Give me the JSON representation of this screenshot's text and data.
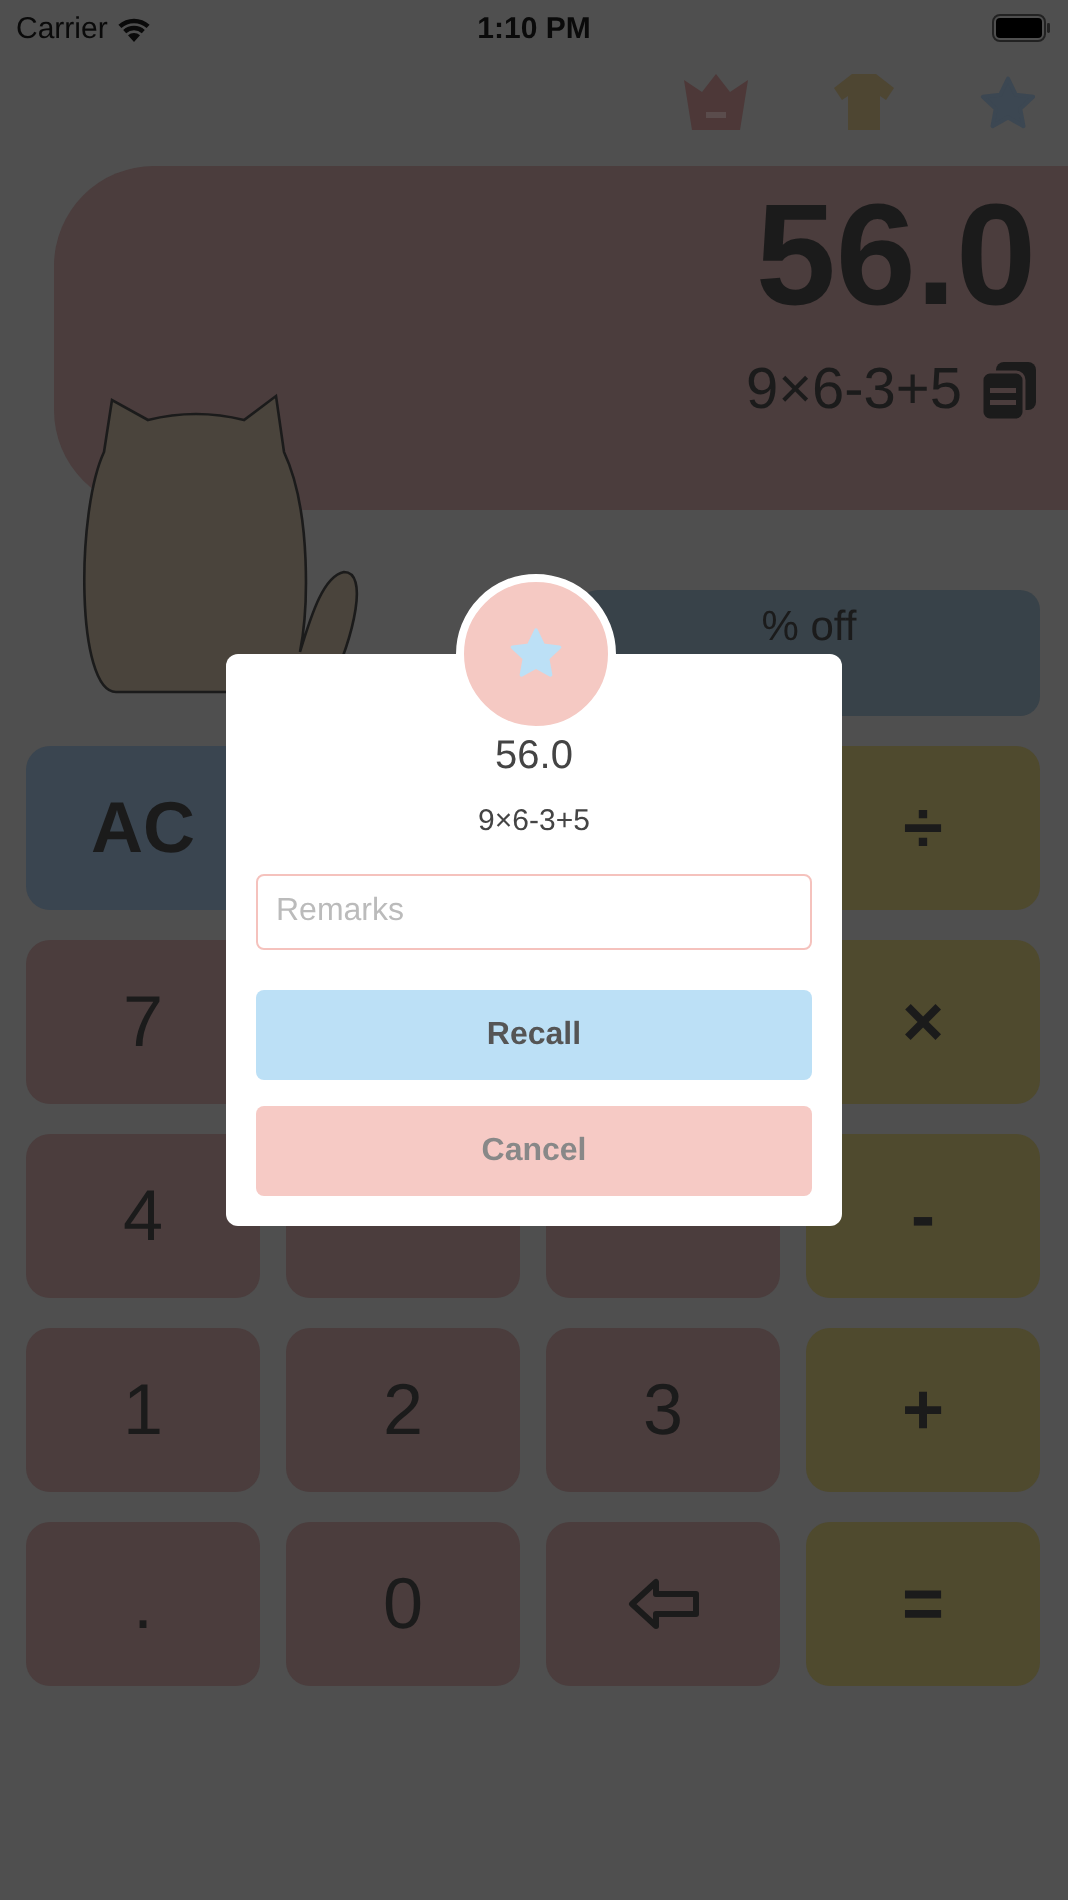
{
  "status_bar": {
    "carrier": "Carrier",
    "time": "1:10 PM"
  },
  "display": {
    "result": "56.0",
    "expression": "9×6-3+5"
  },
  "discount_button": {
    "label": "% off"
  },
  "keys": [
    {
      "kind": "clear",
      "label": "AC"
    },
    {
      "kind": "hidden"
    },
    {
      "kind": "hidden"
    },
    {
      "kind": "operator",
      "label": "÷"
    },
    {
      "kind": "digit",
      "label": "7"
    },
    {
      "kind": "hidden"
    },
    {
      "kind": "hidden"
    },
    {
      "kind": "operator",
      "label": "×"
    },
    {
      "kind": "digit",
      "label": "4"
    },
    {
      "kind": "blank"
    },
    {
      "kind": "blank"
    },
    {
      "kind": "operator",
      "label": "-"
    },
    {
      "kind": "digit",
      "label": "1"
    },
    {
      "kind": "digit",
      "label": "2"
    },
    {
      "kind": "digit",
      "label": "3"
    },
    {
      "kind": "operator",
      "label": "+"
    },
    {
      "kind": "digit",
      "label": "."
    },
    {
      "kind": "digit",
      "label": "0"
    },
    {
      "kind": "backspace"
    },
    {
      "kind": "operator",
      "label": "="
    }
  ],
  "dialog": {
    "value": "56.0",
    "expression": "9×6-3+5",
    "remarks_placeholder": "Remarks",
    "buttons": [
      {
        "kind": "primary",
        "label": "Recall"
      },
      {
        "kind": "secondary",
        "label": "Cancel"
      }
    ]
  }
}
